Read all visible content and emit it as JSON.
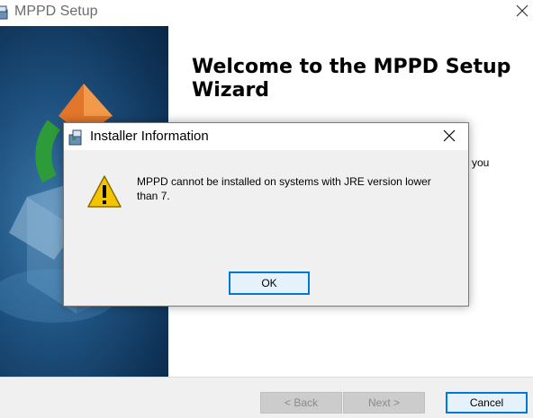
{
  "window": {
    "title": "MPPD Setup",
    "close_icon": "close-icon"
  },
  "main": {
    "heading": "Welcome to the MPPD Setup Wizard",
    "partial_text": "you"
  },
  "footer": {
    "back_label": "< Back",
    "next_label": "Next >",
    "cancel_label": "Cancel"
  },
  "dialog": {
    "title": "Installer Information",
    "message": "MPPD cannot be installed on systems with JRE version lower than 7.",
    "ok_label": "OK",
    "icon": "warning-icon"
  },
  "colors": {
    "accent": "#0078d7",
    "banner": "#1d4f7d",
    "footer_bg": "#f0f0f0"
  }
}
